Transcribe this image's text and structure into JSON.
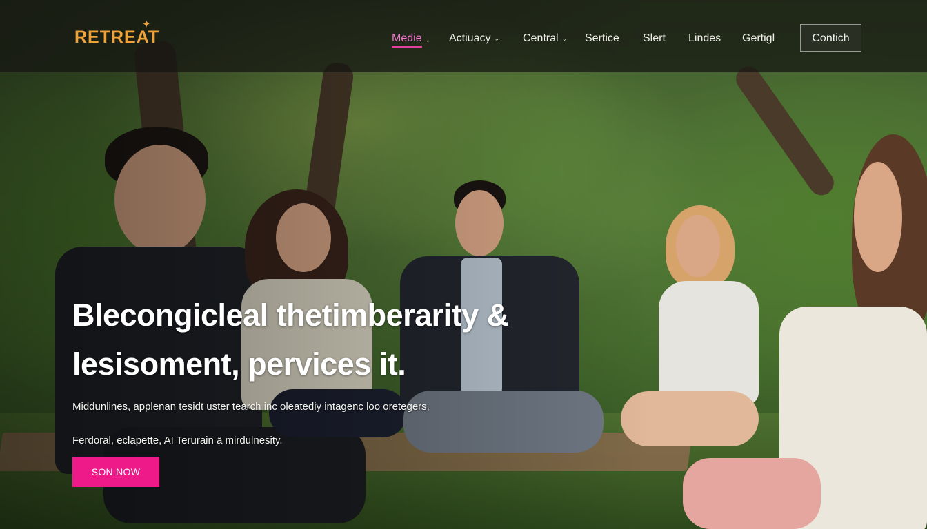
{
  "brand": {
    "logo": "RETREAT",
    "accent": "#f0a23a"
  },
  "nav": {
    "items": [
      {
        "label": "Medie",
        "active": true,
        "dropdown": true
      },
      {
        "label": "Actiuacy",
        "dropdown": true
      },
      {
        "label": "Central",
        "dropdown": true
      },
      {
        "label": "Sertice"
      },
      {
        "label": "Slert"
      },
      {
        "label": "Lindes"
      },
      {
        "label": "Gertigl"
      }
    ],
    "contact_label": "Contich"
  },
  "hero": {
    "headline_line1": "Blecongicleal thetimberarity &",
    "headline_line2": "lesisoment, pervices it.",
    "sub_line1": "Middunlines, applenan tesidt uster tearch inc oleatediy intagenc loo oretegers,",
    "sub_line2": "Ferdoral, eclapette, AI Terurain ä mirdulnesity.",
    "cta_label": "SON NOW",
    "cta_color": "#ee1a8a"
  }
}
